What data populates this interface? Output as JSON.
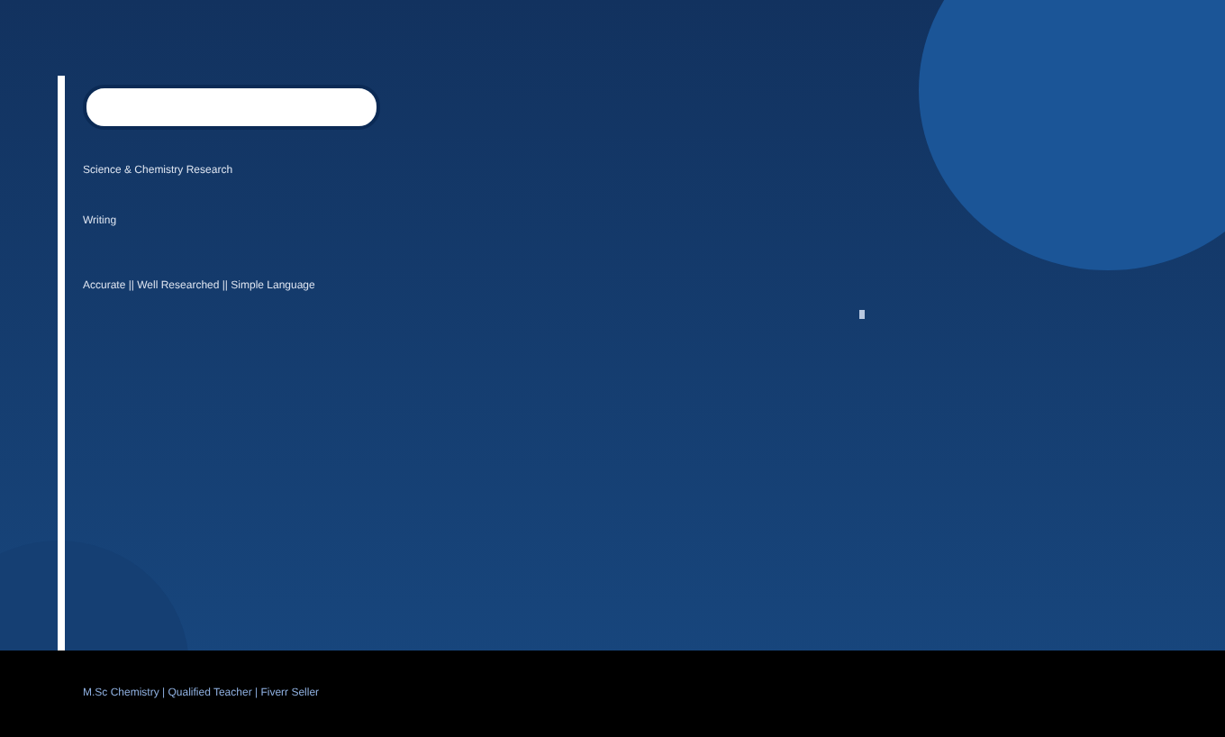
{
  "lines": [
    {
      "kind": "subtitle",
      "text": "Science & Chemistry Research"
    },
    {
      "kind": "subtitle",
      "text": "Writing"
    },
    {
      "kind": "tagline",
      "text": "Accurate || Well Researched || Simple Language"
    }
  ],
  "footer": {
    "text": "M.Sc Chemistry | Qualified Teacher | Fiverr Seller"
  }
}
